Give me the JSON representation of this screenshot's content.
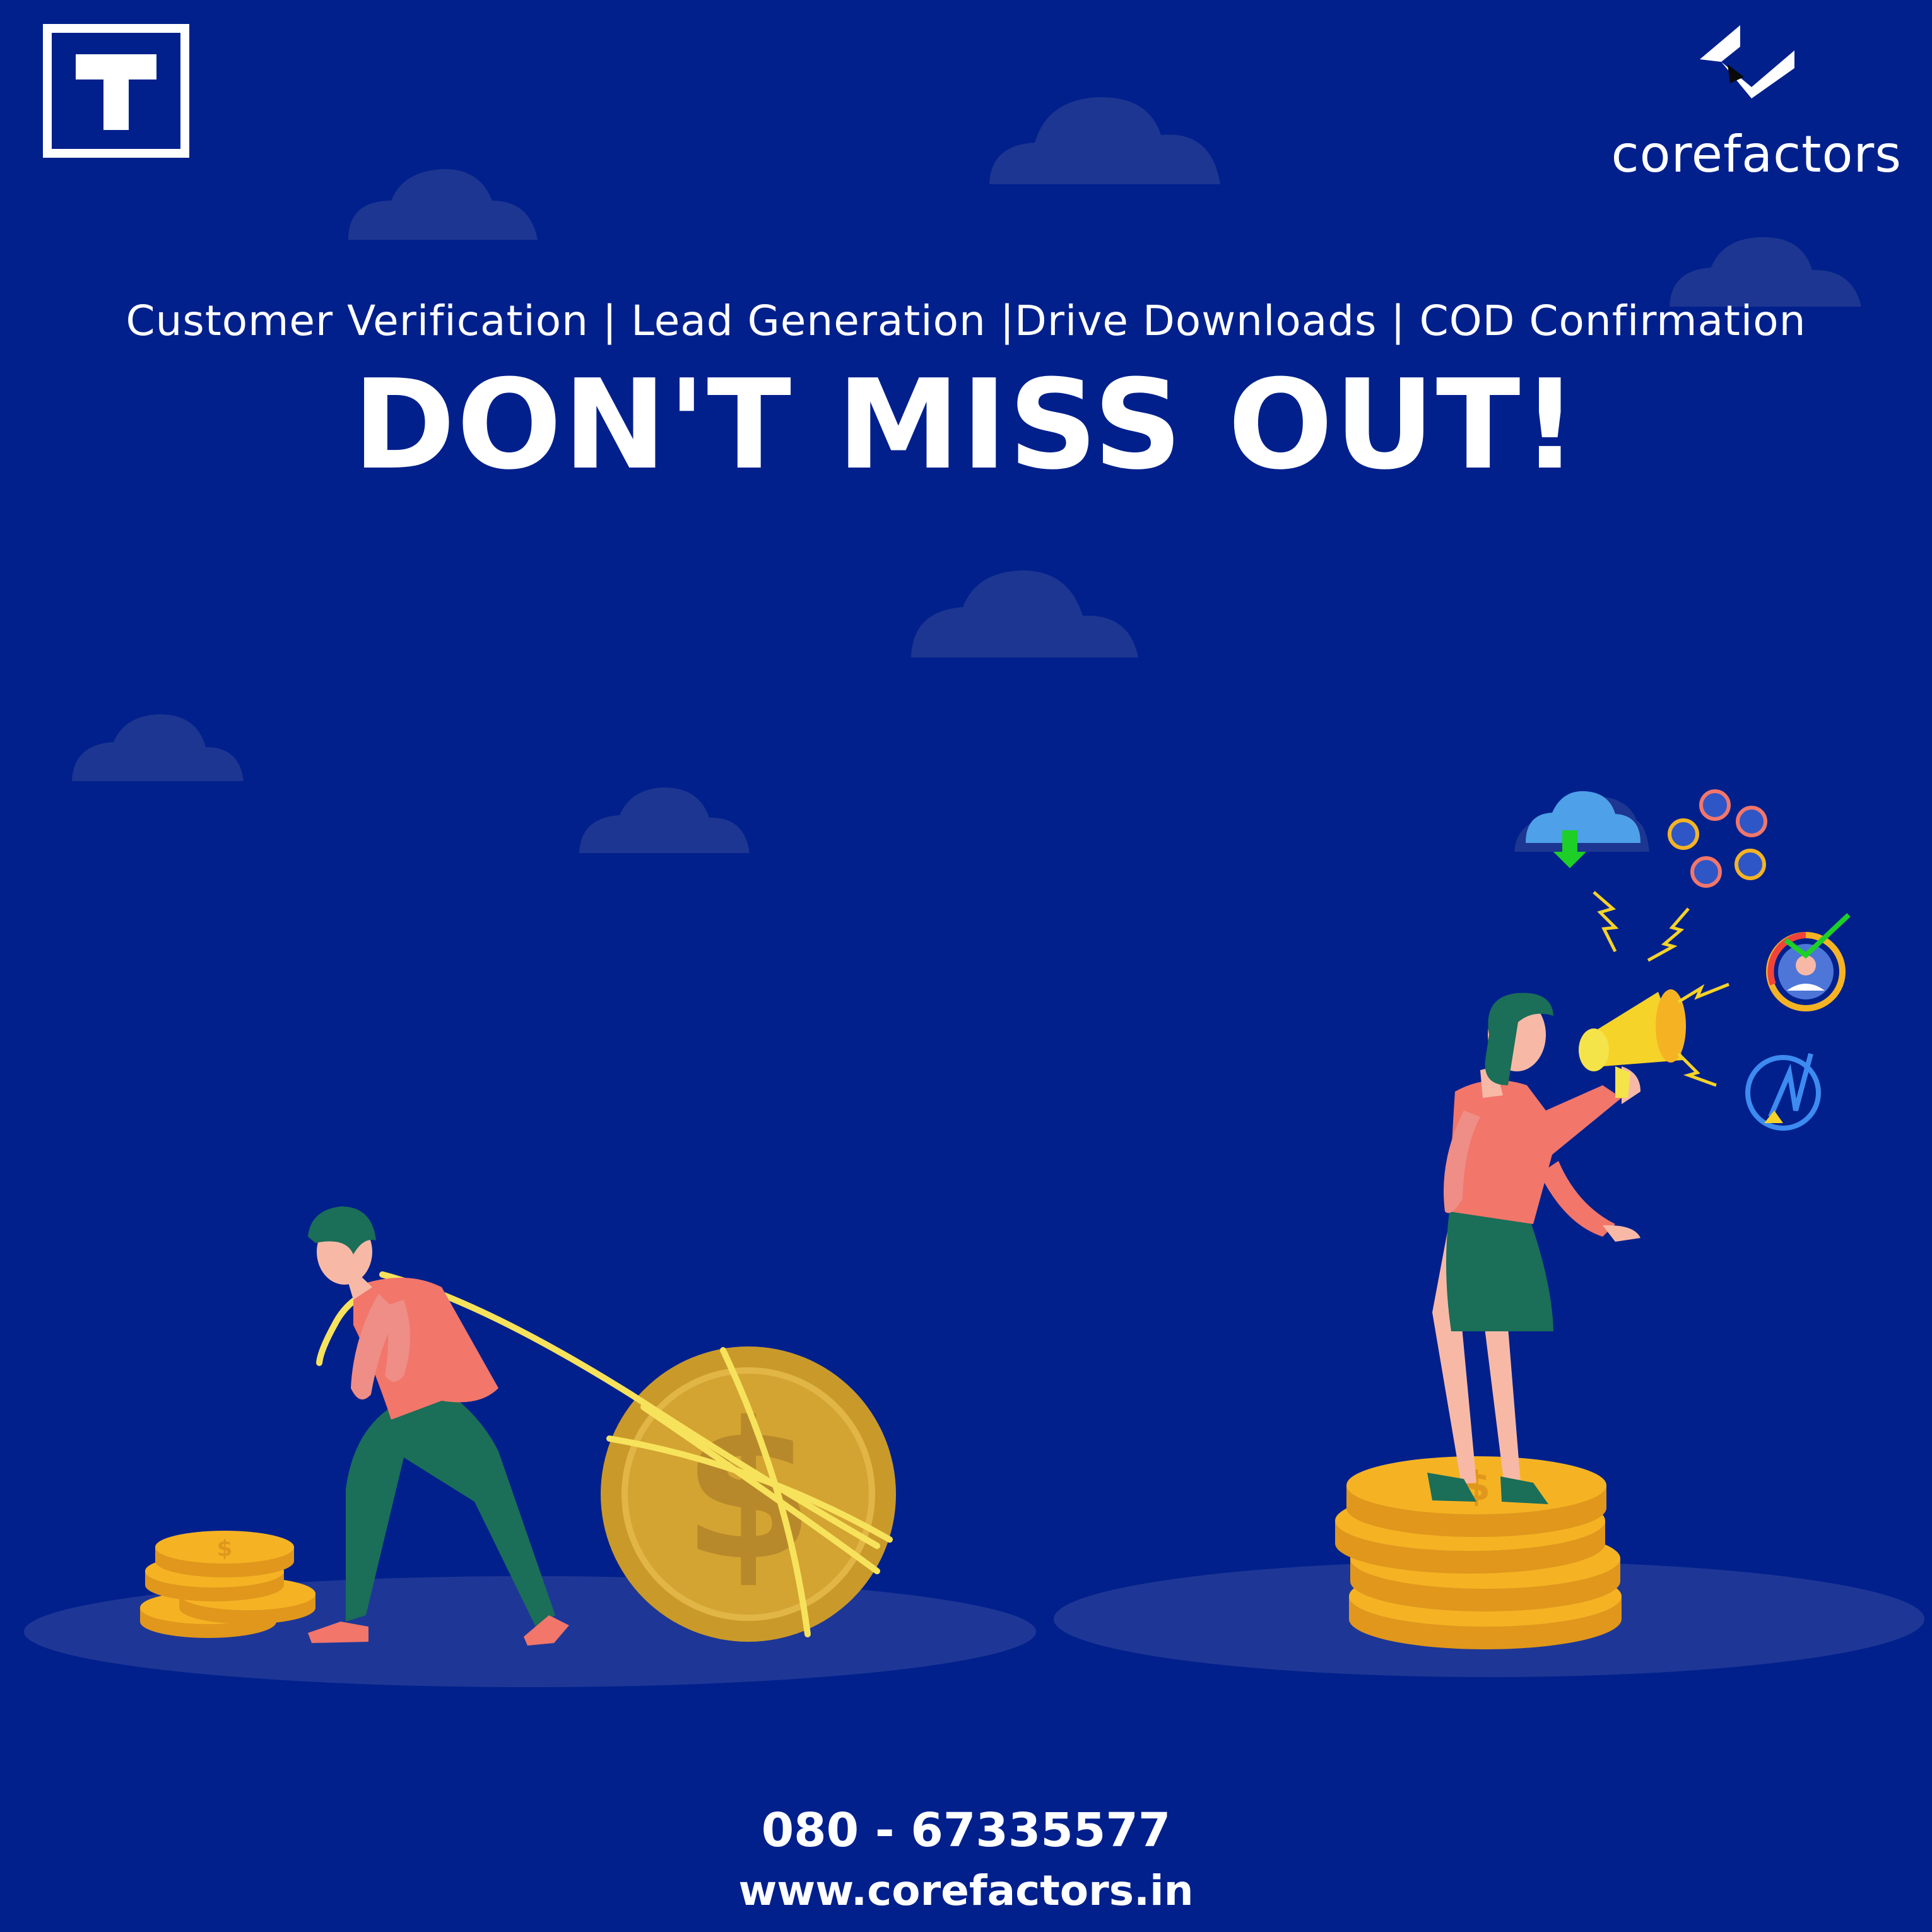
{
  "brand": {
    "name": "corefactors",
    "logo_icon": "corefactors-chevron-logo",
    "corner_icon": "t-letter-logo",
    "corner_letter": "T"
  },
  "tagline": "Customer Verification | Lead Generation |Drive Downloads | COD Confirmation",
  "headline": "DON'T MISS OUT!",
  "contact": {
    "phone": "080 - 67335577",
    "website": "www.corefactors.in"
  },
  "coin_symbol": "$",
  "colors": {
    "background": "#01208c",
    "cloud": "#1d3691",
    "ground": "#1e3796",
    "coin_gold": "#f5b324",
    "coin_dark": "#c99a2a",
    "shirt": "#f2766a",
    "pants": "#1b6e58",
    "rope": "#f7e25c",
    "text": "#ffffff"
  },
  "icons": [
    "cloud-download-icon",
    "people-network-icon",
    "lightning-icon",
    "user-check-icon",
    "growth-chart-icon",
    "megaphone-icon"
  ]
}
